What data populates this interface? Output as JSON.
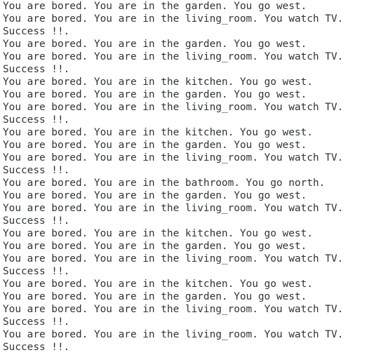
{
  "terminal": {
    "lines": [
      "You are bored. You are in the garden. You go west.",
      "You are bored. You are in the living_room. You watch TV.",
      "Success !!.",
      "You are bored. You are in the garden. You go west.",
      "You are bored. You are in the living_room. You watch TV.",
      "Success !!.",
      "You are bored. You are in the kitchen. You go west.",
      "You are bored. You are in the garden. You go west.",
      "You are bored. You are in the living_room. You watch TV.",
      "Success !!.",
      "You are bored. You are in the kitchen. You go west.",
      "You are bored. You are in the garden. You go west.",
      "You are bored. You are in the living_room. You watch TV.",
      "Success !!.",
      "You are bored. You are in the bathroom. You go north.",
      "You are bored. You are in the garden. You go west.",
      "You are bored. You are in the living_room. You watch TV.",
      "Success !!.",
      "You are bored. You are in the kitchen. You go west.",
      "You are bored. You are in the garden. You go west.",
      "You are bored. You are in the living_room. You watch TV.",
      "Success !!.",
      "You are bored. You are in the kitchen. You go west.",
      "You are bored. You are in the garden. You go west.",
      "You are bored. You are in the living_room. You watch TV.",
      "Success !!.",
      "You are bored. You are in the living_room. You watch TV.",
      "Success !!."
    ]
  },
  "colors": {
    "background": "#ffffff",
    "text": "#2e3436"
  }
}
